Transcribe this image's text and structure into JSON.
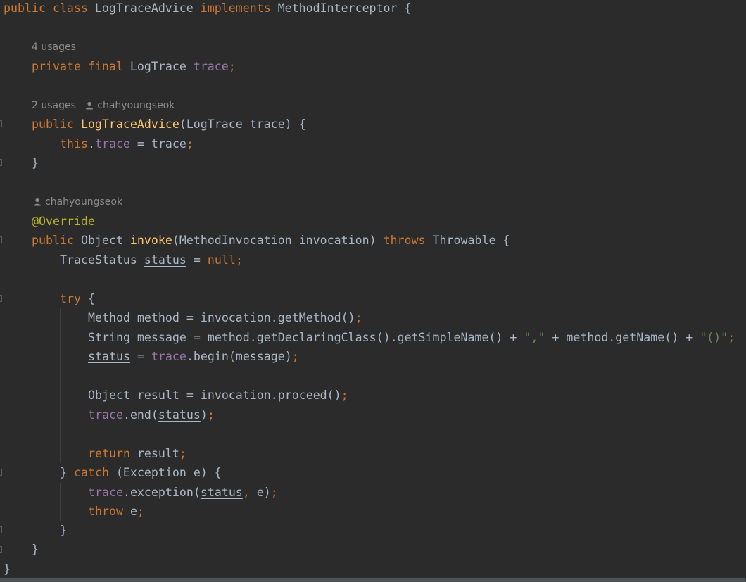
{
  "hints": {
    "field_usages": "4 usages",
    "ctor_usages": "2 usages",
    "ctor_author": "chahyoungseok",
    "method_author": "chahyoungseok"
  },
  "code": {
    "l1": {
      "kw1": "public",
      "kw2": "class",
      "cls": "LogTraceAdvice",
      "kw3": "implements",
      "iface": "MethodInterceptor",
      "brace": "{"
    },
    "field": {
      "kw1": "private",
      "kw2": "final",
      "type": "LogTrace",
      "name": "trace",
      "semi": ";"
    },
    "ctor": {
      "kw": "public",
      "name": "LogTraceAdvice",
      "params": "(LogTrace trace) {"
    },
    "assign": {
      "kw": "this",
      "dot": ".",
      "fld": "trace",
      "rest": " = trace",
      "semi": ";"
    },
    "ctor_close": "}",
    "annotation": "@Override",
    "invoke": {
      "kw1": "public",
      "ret": "Object",
      "name": "invoke",
      "params": "(MethodInvocation invocation)",
      "kw2": "throws",
      "exc": "Throwable {"
    },
    "status_decl": {
      "type": "TraceStatus",
      "var": "status",
      "eq": " = ",
      "kw": "null",
      "semi": ";"
    },
    "try_line": {
      "kw": "try",
      "rest": " {"
    },
    "method_line": {
      "text": "Method method = invocation.getMethod()",
      "semi": ";"
    },
    "message_line": {
      "pre": "String message = method.getDeclaringClass().getSimpleName() + ",
      "s1": "\",\"",
      "mid": " + method.getName() + ",
      "s2": "\"()\"",
      "semi": ";"
    },
    "status_assign": {
      "var": "status",
      "eq": " = ",
      "fld": "trace",
      "rest": ".begin(message)",
      "semi": ";"
    },
    "result_line": {
      "text": "Object result = invocation.proceed()",
      "semi": ";"
    },
    "end_line": {
      "fld": "trace",
      "pre": ".end(",
      "var": "status",
      "post": ")",
      "semi": ";"
    },
    "return_line": {
      "kw": "return",
      "rest": " result",
      "semi": ";"
    },
    "catch_line": {
      "close": "} ",
      "kw": "catch",
      "rest": " (Exception e) {"
    },
    "exception_line": {
      "fld": "trace",
      "pre": ".exception(",
      "var": "status",
      "comma": ",",
      "post": " e)",
      "semi": ";"
    },
    "throw_line": {
      "kw": "throw",
      "rest": " e",
      "semi": ";"
    },
    "catch_close": "}",
    "method_close": "}",
    "class_close": "}"
  }
}
